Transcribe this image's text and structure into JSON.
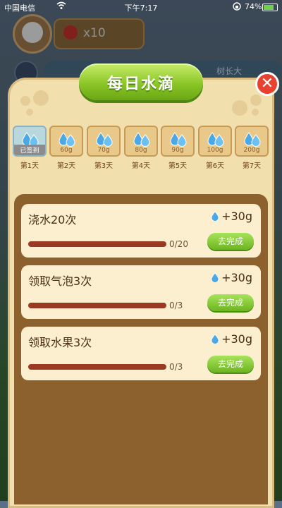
{
  "status_bar": {
    "carrier": "中国电信",
    "time": "下午7:17",
    "battery": "74%",
    "battery_level": 0.74
  },
  "hud": {
    "apple_count": "x10",
    "banner_text": "树长大"
  },
  "dialog": {
    "title": "每日水滴",
    "close_label": "✕",
    "days": [
      {
        "label": "第1天",
        "amount": "已签到",
        "signed": true
      },
      {
        "label": "第2天",
        "amount": "60g",
        "signed": false
      },
      {
        "label": "第3天",
        "amount": "70g",
        "signed": false
      },
      {
        "label": "第4天",
        "amount": "80g",
        "signed": false
      },
      {
        "label": "第5天",
        "amount": "90g",
        "signed": false
      },
      {
        "label": "第6天",
        "amount": "100g",
        "signed": false
      },
      {
        "label": "第7天",
        "amount": "200g",
        "signed": false
      }
    ],
    "tasks": [
      {
        "name": "浇水20次",
        "reward": "+30g",
        "progress": "0/20",
        "progress_value": 0,
        "button": "去完成"
      },
      {
        "name": "领取气泡3次",
        "reward": "+30g",
        "progress": "0/3",
        "progress_value": 0,
        "button": "去完成"
      },
      {
        "name": "领取水果3次",
        "reward": "+30g",
        "progress": "0/3",
        "progress_value": 0,
        "button": "去完成"
      }
    ]
  },
  "colors": {
    "panel": "#f2dfae",
    "title_green": "#87c323",
    "close_red": "#e8412f",
    "progress_bar": "#9a3a22"
  }
}
